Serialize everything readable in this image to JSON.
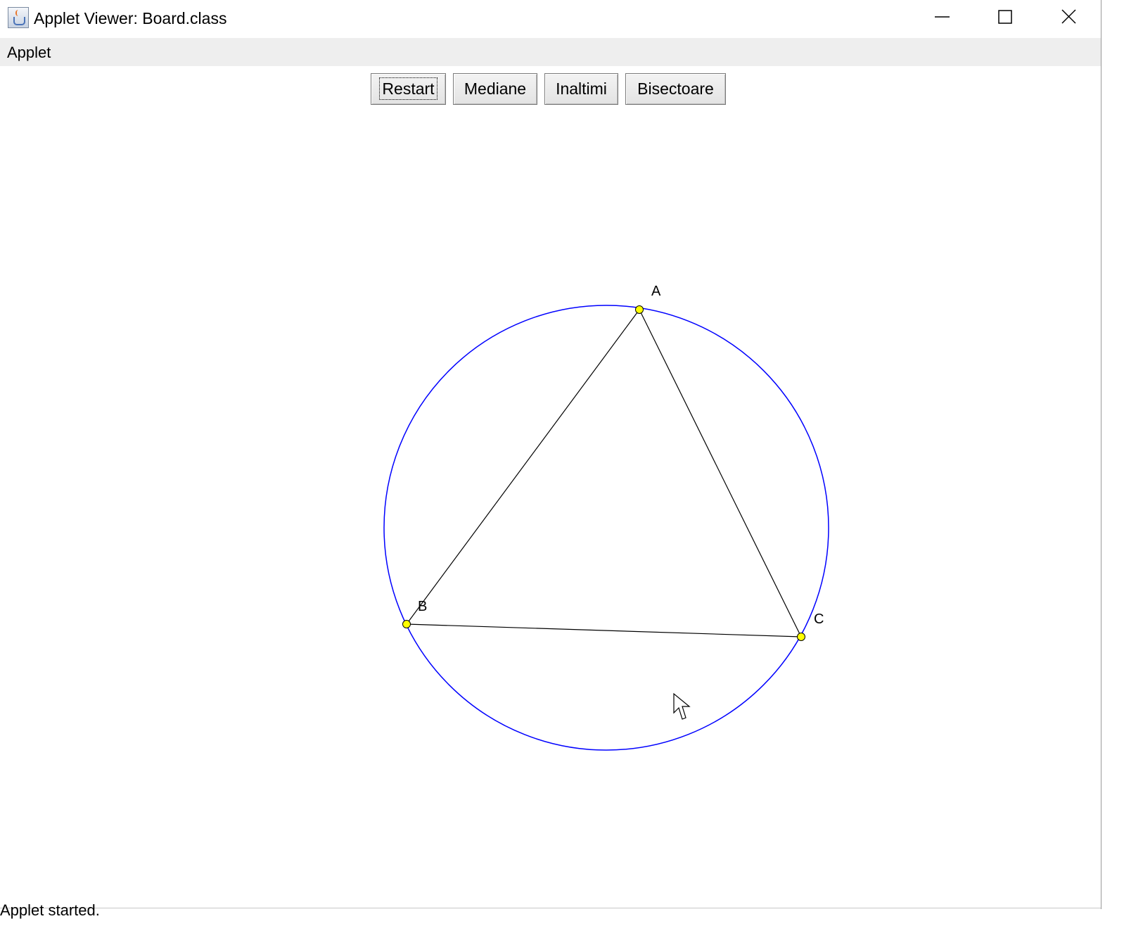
{
  "window": {
    "title": "Applet Viewer: Board.class",
    "icon": "java-applet-icon",
    "controls": [
      "minimize-icon",
      "maximize-icon",
      "close-icon"
    ]
  },
  "menubar": {
    "applet_label": "Applet"
  },
  "toolbar": {
    "restart_label": "Restart",
    "mediane_label": "Mediane",
    "inaltimi_label": "Inaltimi",
    "bisectoare_label": "Bisectoare",
    "focused": "Restart"
  },
  "board": {
    "points": [
      {
        "label": "A"
      },
      {
        "label": "B"
      },
      {
        "label": "C"
      }
    ],
    "circle_color": "#0000ff",
    "segment_color": "#000000",
    "point_color": "#ffff00"
  },
  "status": {
    "text": "Applet started."
  }
}
